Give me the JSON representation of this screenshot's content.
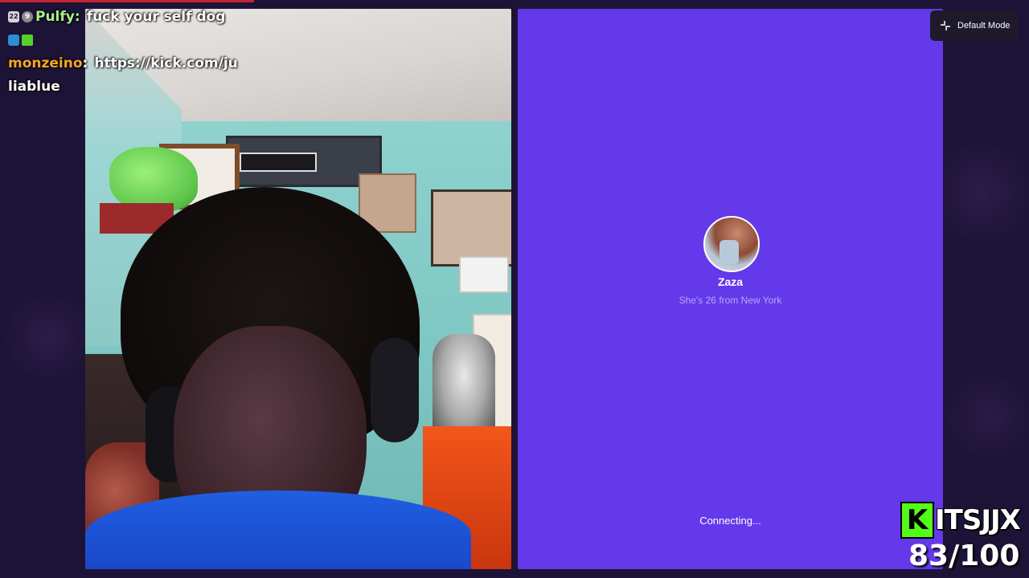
{
  "chat": {
    "messages": [
      {
        "user": "Pulfy",
        "text": "fuck your self dog",
        "user_color": "#a6f08a",
        "badges": [
          "sub-badge-icon",
          "coin-badge-icon"
        ],
        "badge_text": [
          "22",
          "9"
        ]
      },
      {
        "user": "",
        "text": "",
        "badges": [
          "tool-badge-icon",
          "green-badge-icon"
        ]
      },
      {
        "user": "monzeino",
        "text": "https://kick.com/ju",
        "user_color": "#f5a623",
        "separator": ":"
      },
      {
        "user": "liablue",
        "text": ""
      }
    ]
  },
  "call_panel": {
    "background": "#6339ea",
    "profile_name": "Zaza",
    "profile_sub": "She's 26 from New York",
    "status": "Connecting..."
  },
  "mode_button": {
    "label": "Default Mode",
    "icon": "collapse-icon"
  },
  "brand": {
    "logo_letter": "K",
    "name": "ITSJJX",
    "logo_color": "#53fc18"
  },
  "goal": {
    "text": "83/100"
  }
}
